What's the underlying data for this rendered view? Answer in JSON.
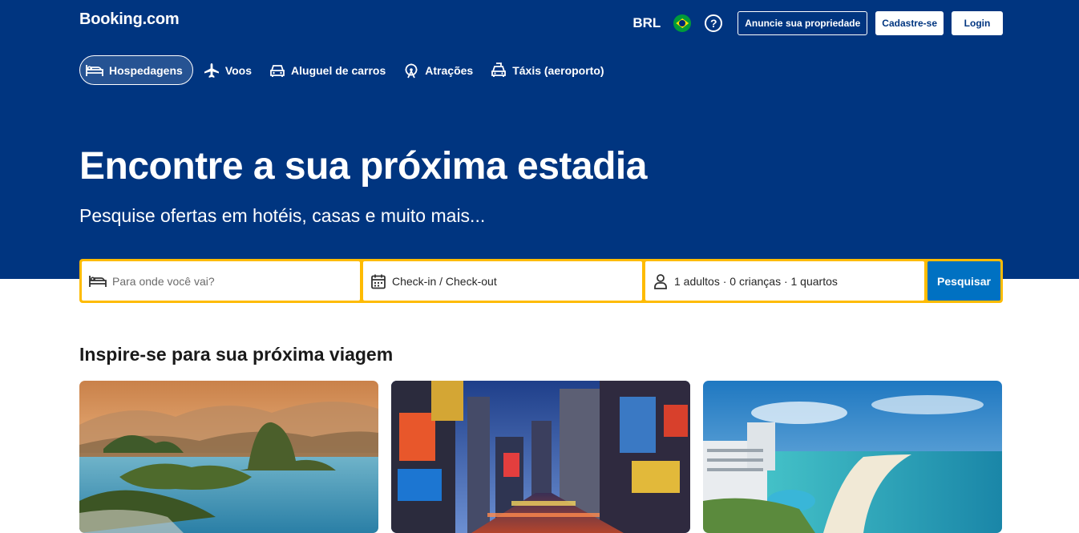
{
  "brand": "Booking.com",
  "header": {
    "currency": "BRL",
    "flag_icon": "brazil-flag-icon",
    "help_symbol": "?",
    "list_property": "Anuncie sua propriedade",
    "register": "Cadastre-se",
    "login": "Login"
  },
  "nav": [
    {
      "label": "Hospedagens",
      "icon": "bed-icon",
      "active": true
    },
    {
      "label": "Voos",
      "icon": "plane-icon",
      "active": false
    },
    {
      "label": "Aluguel de carros",
      "icon": "car-icon",
      "active": false
    },
    {
      "label": "Atrações",
      "icon": "ferris-wheel-icon",
      "active": false
    },
    {
      "label": "Táxis (aeroporto)",
      "icon": "taxi-icon",
      "active": false
    }
  ],
  "hero": {
    "title": "Encontre a sua próxima estadia",
    "subtitle": "Pesquise ofertas em hotéis, casas e muito mais..."
  },
  "search": {
    "destination_placeholder": "Para onde você vai?",
    "dates": "Check-in / Check-out",
    "occupancy": "1 adultos · 0 crianças · 1 quartos",
    "button": "Pesquisar"
  },
  "inspire": {
    "title": "Inspire-se para sua próxima viagem"
  },
  "colors": {
    "brand_blue": "#003580",
    "search_yellow": "#febb02",
    "button_blue": "#0071c2"
  }
}
